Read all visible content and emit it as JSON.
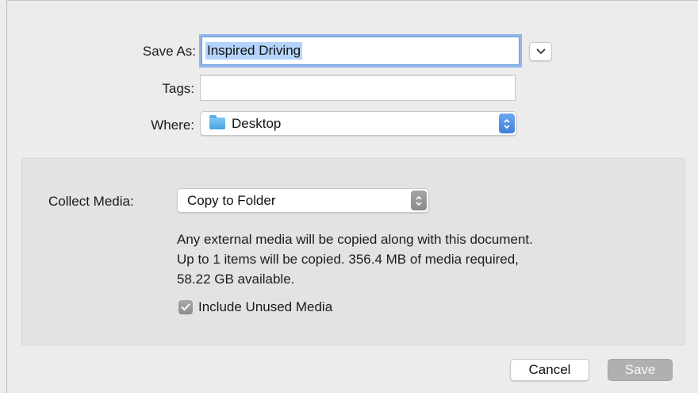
{
  "form": {
    "save_as_label": "Save As:",
    "save_as_value": "Inspired Driving",
    "tags_label": "Tags:",
    "tags_value": "",
    "where_label": "Where:",
    "where_value": "Desktop",
    "where_icon": "folder-icon"
  },
  "collect": {
    "label": "Collect Media:",
    "value": "Copy to Folder",
    "description_lines": [
      "Any external media will be copied along with this document.",
      "Up to 1 items will be copied. 356.4 MB of media required,",
      "58.22 GB available."
    ],
    "checkbox_label": "Include Unused Media",
    "checkbox_checked": true
  },
  "buttons": {
    "cancel": "Cancel",
    "save": "Save",
    "save_enabled": false
  },
  "colors": {
    "accent": "#3f7fdc",
    "focus_ring": "#8eb6ec",
    "selection": "#b4d3fb"
  }
}
